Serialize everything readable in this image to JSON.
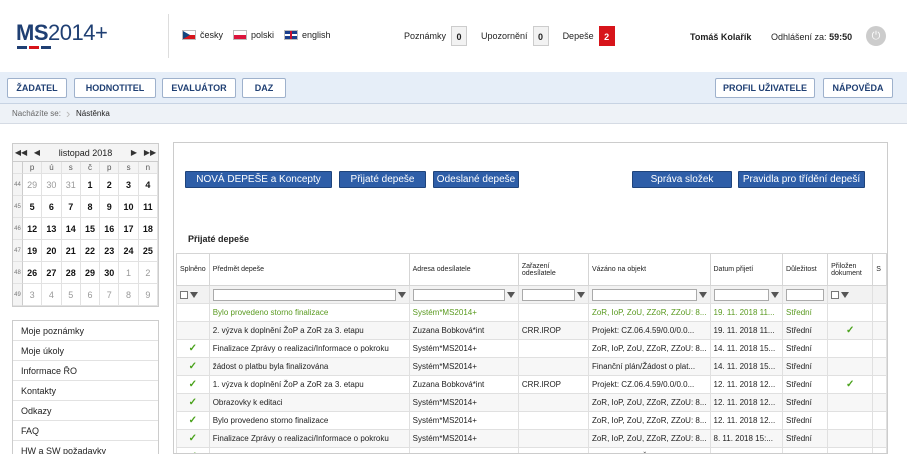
{
  "header": {
    "logo_main": "MS",
    "logo_year": "2014+",
    "languages": [
      "česky",
      "polski",
      "english"
    ],
    "counters": [
      {
        "label": "Poznámky",
        "value": "0"
      },
      {
        "label": "Upozornění",
        "value": "0"
      },
      {
        "label": "Depeše",
        "value": "2"
      }
    ],
    "user": "Tomáš Kolařík",
    "logout_label": "Odhlášení za:",
    "logout_time": "59:50"
  },
  "nav": {
    "left": [
      "ŽADATEL",
      "HODNOTITEL",
      "EVALUÁTOR",
      "DAZ"
    ],
    "right": [
      "PROFIL UŽIVATELE",
      "NÁPOVĚDA"
    ]
  },
  "breadcrumb": {
    "label": "Nacházíte se:",
    "item": "Nástěnka"
  },
  "calendar": {
    "title": "listopad 2018",
    "nav": [
      "◀◀",
      "◀",
      "▶",
      "▶▶"
    ],
    "day_headers": [
      "p",
      "ú",
      "s",
      "č",
      "p",
      "s",
      "n"
    ],
    "weeks": [
      {
        "wk": "44",
        "days": [
          "29",
          "30",
          "31",
          "1",
          "2",
          "3",
          "4"
        ]
      },
      {
        "wk": "45",
        "days": [
          "5",
          "6",
          "7",
          "8",
          "9",
          "10",
          "11"
        ]
      },
      {
        "wk": "46",
        "days": [
          "12",
          "13",
          "14",
          "15",
          "16",
          "17",
          "18"
        ]
      },
      {
        "wk": "47",
        "days": [
          "19",
          "20",
          "21",
          "22",
          "23",
          "24",
          "25"
        ]
      },
      {
        "wk": "48",
        "days": [
          "26",
          "27",
          "28",
          "29",
          "30",
          "1",
          "2"
        ]
      },
      {
        "wk": "49",
        "days": [
          "3",
          "4",
          "5",
          "6",
          "7",
          "8",
          "9"
        ]
      }
    ]
  },
  "side_menu": [
    "Moje poznámky",
    "Moje úkoly",
    "Informace ŘO",
    "Kontakty",
    "Odkazy",
    "FAQ",
    "HW a SW požadavky"
  ],
  "toolbar": {
    "new": "NOVÁ DEPEŠE a Koncepty",
    "received": "Přijaté depeše",
    "sent": "Odeslané depeše",
    "folders": "Správa složek",
    "rules": "Pravidla pro třídění depeší"
  },
  "section_title": "Přijaté depeše",
  "table": {
    "headers": [
      "Splněno",
      "Předmět depeše",
      "Adresa odesílatele",
      "Zařazení odesílatele",
      "Vázáno na objekt",
      "Datum přijetí",
      "Důležitost",
      "Přiložen dokument",
      "S"
    ],
    "rows": [
      {
        "done": "",
        "subject": "Bylo provedeno storno finalizace",
        "sender": "Systém*MS2014+",
        "role": "",
        "object": "ZoR, IoP, ZoU, ZZoR, ZZoU: 8...",
        "date": "19. 11. 2018 11...",
        "priority": "Střední",
        "doc": "",
        "green": true
      },
      {
        "done": "",
        "subject": "2. výzva k doplnění ŽoP a ZoR za 3. etapu",
        "sender": "Zuzana Bobková*int",
        "role": "CRR.IROP",
        "object": "Projekt: CZ.06.4.59/0.0/0.0...",
        "date": "19. 11. 2018 11...",
        "priority": "Střední",
        "doc": "✓",
        "green": false
      },
      {
        "done": "✓",
        "subject": "Finalizace Zprávy o realizaci/Informace o pokroku",
        "sender": "Systém*MS2014+",
        "role": "",
        "object": "ZoR, IoP, ZoU, ZZoR, ZZoU: 8...",
        "date": "14. 11. 2018 15...",
        "priority": "Střední",
        "doc": "",
        "green": false
      },
      {
        "done": "✓",
        "subject": "žádost o platbu byla finalizována",
        "sender": "Systém*MS2014+",
        "role": "",
        "object": "Finanční plán/Žádost o plat...",
        "date": "14. 11. 2018 15...",
        "priority": "Střední",
        "doc": "",
        "green": false
      },
      {
        "done": "✓",
        "subject": "1. výzva k doplnění ŽoP a ZoR za 3. etapu",
        "sender": "Zuzana Bobková*int",
        "role": "CRR.IROP",
        "object": "Projekt: CZ.06.4.59/0.0/0.0...",
        "date": "12. 11. 2018 12...",
        "priority": "Střední",
        "doc": "✓",
        "green": false
      },
      {
        "done": "✓",
        "subject": "Obrazovky k editaci",
        "sender": "Systém*MS2014+",
        "role": "",
        "object": "ZoR, IoP, ZoU, ZZoR, ZZoU: 8...",
        "date": "12. 11. 2018 12...",
        "priority": "Střední",
        "doc": "",
        "green": false
      },
      {
        "done": "✓",
        "subject": "Bylo provedeno storno finalizace",
        "sender": "Systém*MS2014+",
        "role": "",
        "object": "ZoR, IoP, ZoU, ZZoR, ZZoU: 8...",
        "date": "12. 11. 2018 12...",
        "priority": "Střední",
        "doc": "",
        "green": false
      },
      {
        "done": "✓",
        "subject": "Finalizace Zprávy o realizaci/Informace o pokroku",
        "sender": "Systém*MS2014+",
        "role": "",
        "object": "ZoR, IoP, ZoU, ZZoR, ZZoU: 8...",
        "date": "8. 11. 2018 15:...",
        "priority": "Střední",
        "doc": "",
        "green": false
      },
      {
        "done": "✓",
        "subject": "žádost o platbu byla finalizována",
        "sender": "Systém*MS2014+",
        "role": "",
        "object": "Finanční plán/Žádost o plat...",
        "date": "8. 11. 2018 15:...",
        "priority": "Střední",
        "doc": "",
        "green": false
      }
    ]
  },
  "colors": {
    "brand": "#1f3f73",
    "button": "#2e5ea8",
    "alert": "#d7141a",
    "done": "#4aa21c"
  }
}
